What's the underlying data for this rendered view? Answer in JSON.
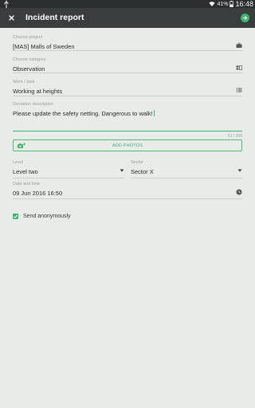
{
  "status_bar": {
    "battery_percent": "41%",
    "time": "16:48"
  },
  "app_bar": {
    "title": "Incident report",
    "close_icon": "close-icon",
    "send_icon": "send-icon"
  },
  "form": {
    "project": {
      "label": "Choose project",
      "value": "[MAS] Malls of Sweden",
      "icon": "briefcase-icon"
    },
    "category": {
      "label": "Choose category",
      "value": "Observation",
      "icon": "category-icon"
    },
    "work_task": {
      "label": "Work / task",
      "value": "Working at heights",
      "icon": "list-icon"
    },
    "description": {
      "label": "Deviation description",
      "value": "Please update the safety netting. Dangerous to walk!",
      "counter": "51 / 256"
    },
    "add_photos": {
      "label": "ADD PHOTOS",
      "icon": "add-camera-icon"
    },
    "level": {
      "label": "Level",
      "value": "Level two"
    },
    "sector": {
      "label": "Sector",
      "value": "Sector X"
    },
    "datetime": {
      "label": "Date and time",
      "value": "09 Jun 2016 16:50",
      "icon": "clock-icon"
    },
    "send_anonymously": {
      "label": "Send anonymously",
      "checked": true
    }
  },
  "colors": {
    "accent": "#3ab56d",
    "app_bar": "#3a3d3e",
    "status_bar": "#2b2e2f",
    "background": "#e8ebe8"
  }
}
